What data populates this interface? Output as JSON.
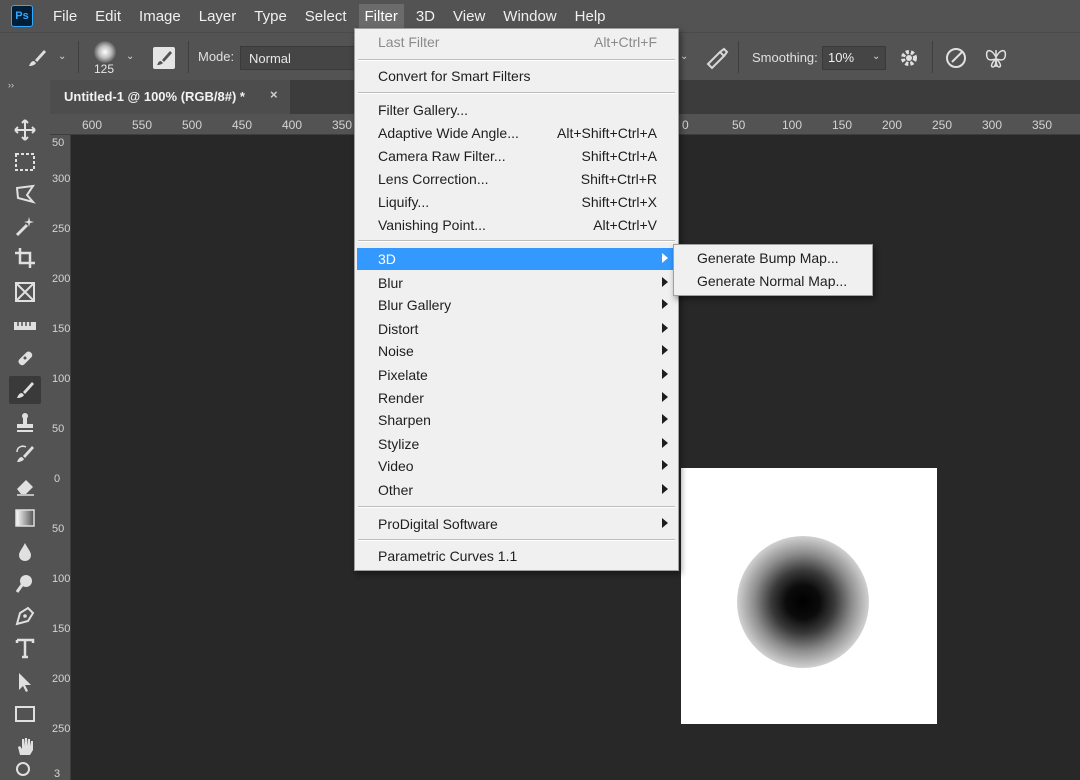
{
  "app": {
    "logo_text": "Ps",
    "brand_color": "#31a8ff"
  },
  "menubar": {
    "items": [
      "File",
      "Edit",
      "Image",
      "Layer",
      "Type",
      "Select",
      "Filter",
      "3D",
      "View",
      "Window",
      "Help"
    ],
    "active": "Filter"
  },
  "options": {
    "brush_size": "125",
    "mode_label": "Mode:",
    "mode_value": "Normal",
    "smoothing_label": "Smoothing:",
    "smoothing_value": "10%"
  },
  "panel_collapse": "››",
  "document_tab": {
    "title": "Untitled-1 @ 100% (RGB/8#) *",
    "close": "×"
  },
  "ruler": {
    "h_labels": [
      "600",
      "550",
      "500",
      "450",
      "400",
      "350",
      "0",
      "50",
      "100",
      "150",
      "200",
      "250",
      "300",
      "350"
    ],
    "v_labels": [
      "50",
      "300",
      "250",
      "200",
      "150",
      "100",
      "50",
      "0",
      "50",
      "100",
      "150",
      "200",
      "250",
      "3"
    ]
  },
  "filter_menu": {
    "items": [
      {
        "label": "Last Filter",
        "shortcut": "Alt+Ctrl+F",
        "disabled": true
      },
      {
        "label": "Convert for Smart Filters",
        "shortcut": ""
      },
      {
        "label": "Filter Gallery...",
        "shortcut": ""
      },
      {
        "label": "Adaptive Wide Angle...",
        "shortcut": "Alt+Shift+Ctrl+A"
      },
      {
        "label": "Camera Raw Filter...",
        "shortcut": "Shift+Ctrl+A"
      },
      {
        "label": "Lens Correction...",
        "shortcut": "Shift+Ctrl+R"
      },
      {
        "label": "Liquify...",
        "shortcut": "Shift+Ctrl+X"
      },
      {
        "label": "Vanishing Point...",
        "shortcut": "Alt+Ctrl+V"
      },
      {
        "label": "3D",
        "submenu": true,
        "highlighted": true
      },
      {
        "label": "Blur",
        "submenu": true
      },
      {
        "label": "Blur Gallery",
        "submenu": true
      },
      {
        "label": "Distort",
        "submenu": true
      },
      {
        "label": "Noise",
        "submenu": true
      },
      {
        "label": "Pixelate",
        "submenu": true
      },
      {
        "label": "Render",
        "submenu": true
      },
      {
        "label": "Sharpen",
        "submenu": true
      },
      {
        "label": "Stylize",
        "submenu": true
      },
      {
        "label": "Video",
        "submenu": true
      },
      {
        "label": "Other",
        "submenu": true
      },
      {
        "label": "ProDigital Software",
        "submenu": true
      },
      {
        "label": "Parametric Curves 1.1",
        "submenu": false
      }
    ],
    "highlight_color": "#3399ff"
  },
  "submenu_3d": {
    "items": [
      "Generate Bump Map...",
      "Generate Normal Map..."
    ]
  },
  "tools": [
    "move-tool-icon",
    "marquee-tool-icon",
    "lasso-tool-icon",
    "magic-wand-tool-icon",
    "crop-tool-icon",
    "frame-tool-icon",
    "ruler-tool-icon",
    "healing-brush-tool-icon",
    "brush-tool-icon",
    "clone-stamp-tool-icon",
    "history-brush-tool-icon",
    "eraser-tool-icon",
    "gradient-tool-icon",
    "blur-tool-icon",
    "dodge-tool-icon",
    "pen-tool-icon",
    "type-tool-icon",
    "path-selection-tool-icon",
    "rectangle-tool-icon",
    "hand-tool-icon",
    "zoom-tool-icon"
  ],
  "selected_tool": "brush-tool-icon"
}
